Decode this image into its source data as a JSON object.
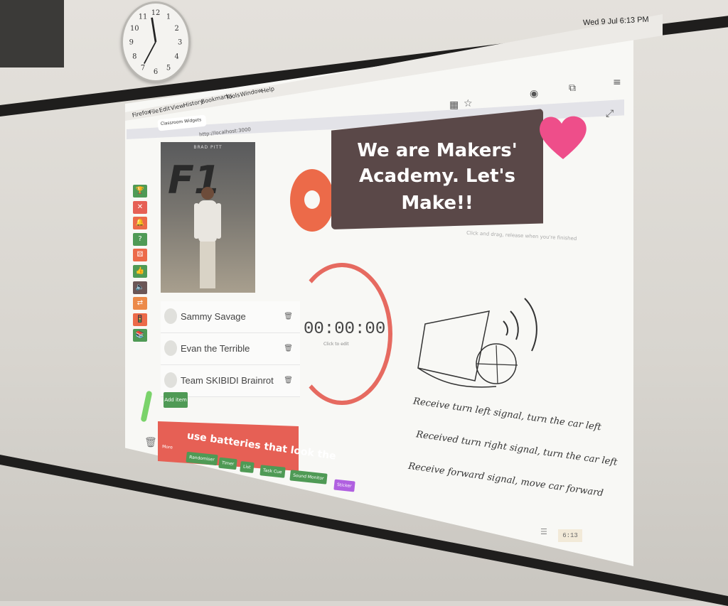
{
  "wall_clock": {
    "numbers": [
      "12",
      "1",
      "2",
      "3",
      "4",
      "5",
      "6",
      "7",
      "8",
      "9",
      "10",
      "11"
    ]
  },
  "menubar": {
    "app": "Firefox",
    "items": [
      "File",
      "Edit",
      "View",
      "History",
      "Bookmarks",
      "Tools",
      "Window",
      "Help"
    ],
    "datetime": "Wed 9 Jul  6:13 PM"
  },
  "browser": {
    "tab_title": "Classroom Widgets",
    "url": "http://localhost:3000"
  },
  "photo": {
    "caption": "BRAD PITT"
  },
  "sidebar": {
    "buttons": [
      {
        "icon": "trophy-icon",
        "glyph": "🏆",
        "color": "#4f9a55"
      },
      {
        "icon": "close-icon",
        "glyph": "✕",
        "color": "#e66055"
      },
      {
        "icon": "bell-icon",
        "glyph": "🔔",
        "color": "#ec6a49"
      },
      {
        "icon": "question-icon",
        "glyph": "?",
        "color": "#4f9a55"
      },
      {
        "icon": "dice-icon",
        "glyph": "⚄",
        "color": "#ec6a49"
      },
      {
        "icon": "thumbs-up-icon",
        "glyph": "👍",
        "color": "#4f9a55"
      },
      {
        "icon": "volume-icon",
        "glyph": "🔈",
        "color": "#6b5656"
      },
      {
        "icon": "swap-icon",
        "glyph": "⇄",
        "color": "#ec8a49"
      },
      {
        "icon": "traffic-icon",
        "glyph": "🚦",
        "color": "#ec6a49"
      },
      {
        "icon": "book-icon",
        "glyph": "📚",
        "color": "#4f9a55"
      }
    ]
  },
  "banner": {
    "lines": [
      "We are Makers'",
      "Academy. Let's",
      "Make!!"
    ],
    "hint": "Click and drag, release when you're finished"
  },
  "timer": {
    "value": "00:00:00",
    "hint": "Click to edit"
  },
  "list": {
    "items": [
      "Sammy Savage",
      "Evan the Terrible",
      "Team SKIBIDI Brainrot"
    ],
    "add_label": "Add item"
  },
  "redbar": {
    "text": "use batteries that look the"
  },
  "bottom_toolbar": [
    {
      "label": "More",
      "color": "#e66055"
    },
    {
      "label": "Randomiser",
      "color": "#4f9a55"
    },
    {
      "label": "Timer",
      "color": "#4f9a55"
    },
    {
      "label": "List",
      "color": "#4f9a55"
    },
    {
      "label": "Task Cue",
      "color": "#4f9a55"
    },
    {
      "label": "Sound Monitor",
      "color": "#4f9a55"
    },
    {
      "label": "Sticker",
      "color": "#b060e0"
    }
  ],
  "notes": [
    "Receive turn left signal, turn the car left",
    "Received turn right signal, turn the car left",
    "Receive forward signal, move car forward"
  ],
  "footer": {
    "clock": "6:13"
  }
}
